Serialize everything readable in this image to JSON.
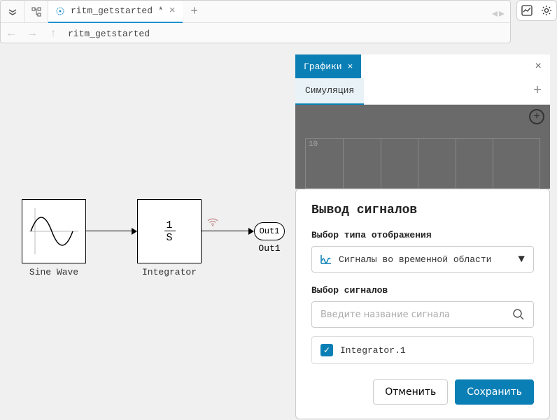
{
  "tab": {
    "title": "ritm_getstarted *"
  },
  "breadcrumb": "ritm_getstarted",
  "blocks": {
    "sine_label": "Sine Wave",
    "integrator_label": "Integrator",
    "integrator_num": "1",
    "integrator_den": "S",
    "out1": "Out1",
    "out1_label": "Out1"
  },
  "panel": {
    "title": "Графики",
    "subtab": "Симуляция"
  },
  "chart_data": {
    "type": "line",
    "tick": "10",
    "values": []
  },
  "modal": {
    "title": "Вывод сигналов",
    "type_label": "Выбор типа отображения",
    "type_value": "Сигналы во временной области",
    "signals_label": "Выбор сигналов",
    "search_placeholder": "Введите название сигнала",
    "signal_1": "Integrator.1",
    "cancel": "Отменить",
    "save": "Сохранить"
  }
}
